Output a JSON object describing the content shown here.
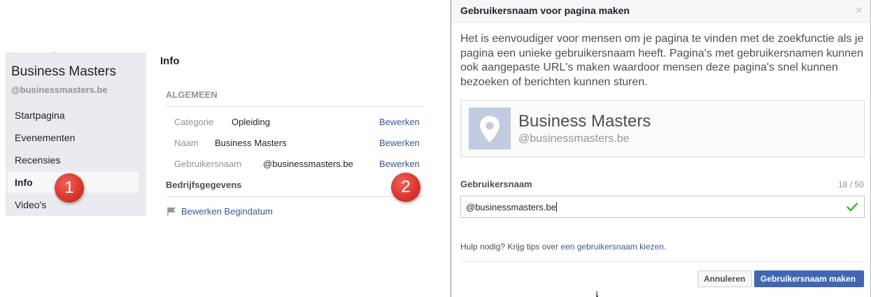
{
  "sidebar": {
    "page_name": "Business Masters",
    "page_handle": "@businessmasters.be",
    "items": [
      {
        "label": "Startpagina"
      },
      {
        "label": "Evenementen"
      },
      {
        "label": "Recensies"
      },
      {
        "label": "Info",
        "active": true
      },
      {
        "label": "Video's"
      }
    ]
  },
  "badges": {
    "step1": "1",
    "step2": "2",
    "color": "#d8342c"
  },
  "info": {
    "title": "Info",
    "general_heading": "ALGEMEEN",
    "rows": [
      {
        "label": "Categorie",
        "value": "Opleiding",
        "edit": "Bewerken"
      },
      {
        "label": "Naam",
        "value": "Business Masters",
        "edit": "Bewerken"
      },
      {
        "label": "Gebruikersnaam",
        "value": "@businessmasters.be",
        "edit": "Bewerken"
      }
    ],
    "company_heading": "Bedrijfsgegevens",
    "start_date_link": "Bewerken Begindatum"
  },
  "dialog": {
    "title": "Gebruikersnaam voor pagina maken",
    "close_icon": "close-icon",
    "description": "Het is eenvoudiger voor mensen om je pagina te vinden met de zoekfunctie als je pagina een unieke gebruikersnaam heeft. Pagina's met gebruikersnamen kunnen ook aangepaste URL's maken waardoor mensen deze pagina's snel kunnen bezoeken of berichten kunnen sturen.",
    "preview_name": "Business Masters",
    "preview_handle": "@businessmasters.be",
    "field_label": "Gebruikersnaam",
    "char_count": "18 / 50",
    "field_value": "@businessmasters.be",
    "help_prefix": "Hulp nodig? Krijg tips over ",
    "help_link": "een gebruikersnaam kiezen",
    "help_suffix": ".",
    "cancel_label": "Annuleren",
    "create_label": "Gebruikersnaam maken",
    "accent_color": "#4267b2",
    "check_color": "#42b72a"
  }
}
